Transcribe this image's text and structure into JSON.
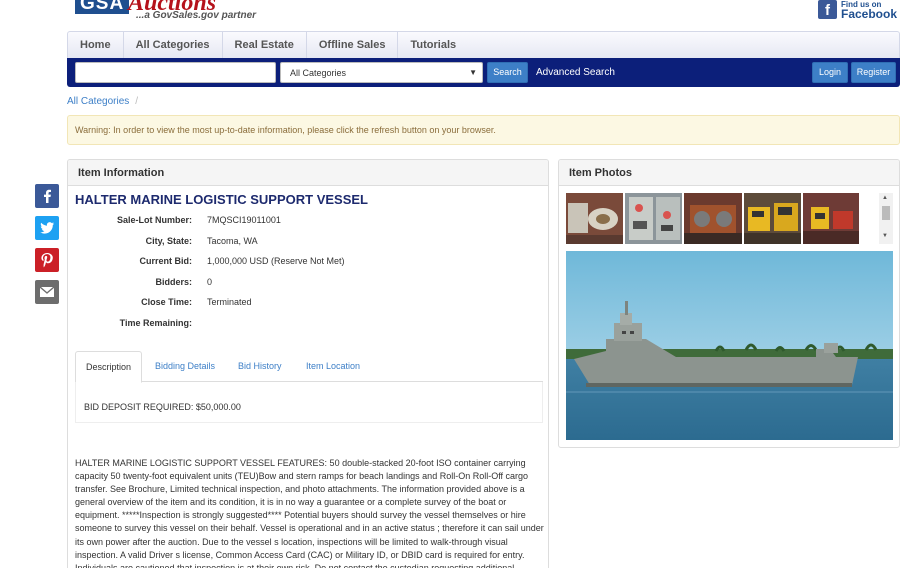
{
  "header": {
    "logo_short": "GSA",
    "logo_name": "Auctions",
    "logo_tagline": "...a GovSales.gov partner",
    "facebook_find": "Find us on",
    "facebook_name": "Facebook",
    "facebook_letter": "f"
  },
  "nav": {
    "items": [
      {
        "label": "Home"
      },
      {
        "label": "All Categories"
      },
      {
        "label": "Real Estate"
      },
      {
        "label": "Offline Sales"
      },
      {
        "label": "Tutorials"
      }
    ]
  },
  "search": {
    "input_value": "",
    "category_selected": "All Categories",
    "search_label": "Search",
    "advanced_label": "Advanced Search",
    "login_label": "Login",
    "register_label": "Register"
  },
  "breadcrumb": {
    "items": [
      {
        "label": "All Categories"
      }
    ],
    "separator": "/"
  },
  "warning_text": "Warning: In order to view the most up-to-date information, please click the refresh button on your browser.",
  "item_info": {
    "panel_title": "Item Information",
    "title": "HALTER MARINE LOGISTIC SUPPORT VESSEL",
    "fields": [
      {
        "label": "Sale-Lot Number:",
        "value": "7MQSCI19011001"
      },
      {
        "label": "City, State:",
        "value": "Tacoma, WA"
      },
      {
        "label": "Current Bid:",
        "value": "1,000,000 USD (Reserve Not Met)"
      },
      {
        "label": "Bidders:",
        "value": "0"
      },
      {
        "label": "Close Time:",
        "value": "Terminated"
      },
      {
        "label": "Time Remaining:",
        "value": ""
      }
    ],
    "tabs": [
      {
        "label": "Description",
        "active": true
      },
      {
        "label": "Bidding Details",
        "active": false
      },
      {
        "label": "Bid History",
        "active": false
      },
      {
        "label": "Item Location",
        "active": false
      }
    ],
    "deposit_text": "BID DEPOSIT REQUIRED: $50,000.00",
    "description": "HALTER MARINE LOGISTIC SUPPORT VESSEL FEATURES: 50 double-stacked 20-foot ISO container carrying capacity 50 twenty-foot equivalent units (TEU)Bow and stern ramps for beach landings and Roll-On Roll-Off cargo transfer. See Brochure, Limited technical inspection, and photo attachments. The information provided above is a general overview of the item and its condition, it is in no way a guarantee or a complete survey of the boat or equipment. *****Inspection is strongly suggested**** Potential buyers should survey the vessel themselves or hire someone to survey this vessel on their behalf. Vessel is operational and in an active status ; therefore it can sail under its own power after the auction. Due to the vessel s location, inspections will be limited to walk-through visual inspection. A valid Driver s license, Common Access Card (CAC) or Military ID, or DBID card is required for entry. Individuals are cautioned that inspection is at their own risk. Do not contact the custodian requesting additional information regarding the condition of"
  },
  "photos": {
    "panel_title": "Item Photos",
    "thumbnail_count": 5
  },
  "social": [
    {
      "icon": "facebook-icon",
      "color": "#3b5998"
    },
    {
      "icon": "twitter-icon",
      "color": "#1da1f2"
    },
    {
      "icon": "pinterest-icon",
      "color": "#cb2027"
    },
    {
      "icon": "email-icon",
      "color": "#6d6d6d"
    }
  ],
  "colors": {
    "accent_blue": "#3d7fc7",
    "navbar_dark": "#0c1f7a",
    "title_navy": "#1d2a6e",
    "logo_red": "#b5121b"
  }
}
